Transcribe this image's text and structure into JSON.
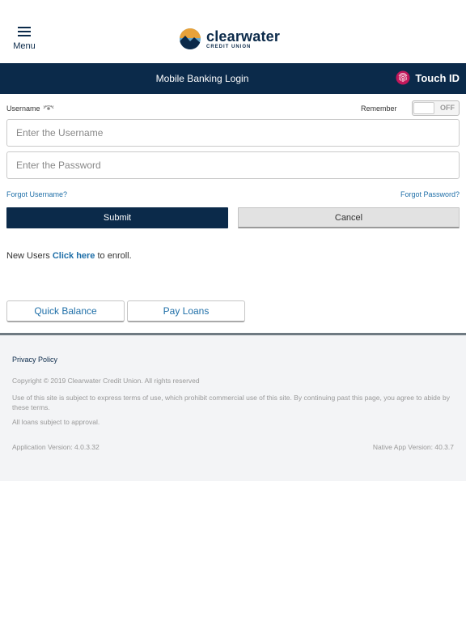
{
  "header": {
    "menu_label": "Menu",
    "logo_name": "clearwater",
    "logo_sub": "CREDIT UNION"
  },
  "titlebar": {
    "title": "Mobile Banking Login",
    "touch_id_label": "Touch ID"
  },
  "form": {
    "username_label": "Username",
    "remember_label": "Remember",
    "remember_toggle": "OFF",
    "username_placeholder": "Enter the Username",
    "password_placeholder": "Enter the Password",
    "forgot_username": "Forgot Username?",
    "forgot_password": "Forgot Password?",
    "submit_label": "Submit",
    "cancel_label": "Cancel"
  },
  "enroll": {
    "prefix": "New Users ",
    "link": "Click here",
    "suffix": " to enroll."
  },
  "quick_actions": {
    "quick_balance": "Quick Balance",
    "pay_loans": "Pay Loans"
  },
  "footer": {
    "privacy": "Privacy Policy",
    "copyright": "Copyright © 2019 Clearwater Credit Union. All rights reserved",
    "terms": "Use of this site is subject to express terms of use, which prohibit commercial use of this site. By continuing past this page, you agree to abide by these terms.",
    "loans": "All loans subject to approval.",
    "app_version": "Application Version: 4.0.3.32",
    "native_version": "Native App Version: 40.3.7"
  },
  "colors": {
    "navy": "#0b2a4a",
    "link_blue": "#1f6fa8",
    "footer_bg": "#f3f4f6",
    "touch_id_accent": "#c2185b"
  },
  "icons": {
    "menu": "hamburger-icon",
    "logo": "mountain-logo-icon",
    "touch_id": "fingerprint-icon",
    "username_hint": "eye-icon"
  }
}
